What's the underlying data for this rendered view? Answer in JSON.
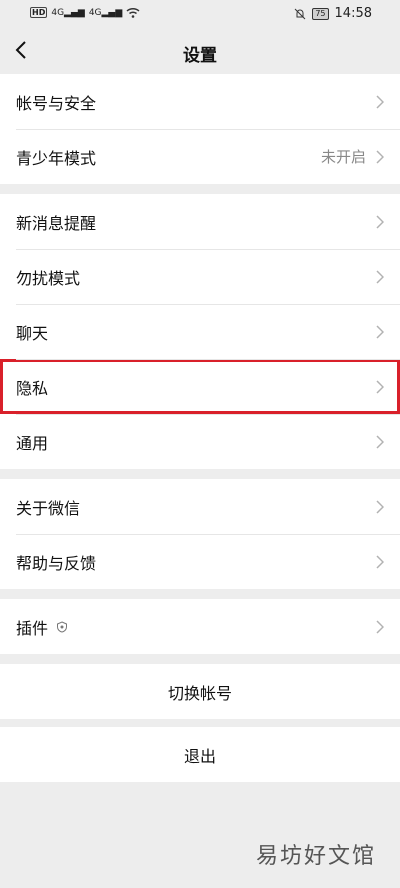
{
  "status_bar": {
    "hd_badge": "HD",
    "signal_1": "4G",
    "signal_2": "4G",
    "battery": "75",
    "time": "14:58"
  },
  "header": {
    "title": "设置"
  },
  "groups": [
    {
      "items": [
        {
          "label": "帐号与安全"
        },
        {
          "label": "青少年模式",
          "value": "未开启"
        }
      ]
    },
    {
      "items": [
        {
          "label": "新消息提醒"
        },
        {
          "label": "勿扰模式"
        },
        {
          "label": "聊天"
        },
        {
          "label": "隐私"
        },
        {
          "label": "通用"
        }
      ]
    },
    {
      "items": [
        {
          "label": "关于微信"
        },
        {
          "label": "帮助与反馈"
        }
      ]
    },
    {
      "items": [
        {
          "label": "插件"
        }
      ]
    }
  ],
  "actions": {
    "switch_account": "切换帐号",
    "logout": "退出"
  },
  "highlight_color": "#d9202a",
  "watermark": "易坊好文馆"
}
